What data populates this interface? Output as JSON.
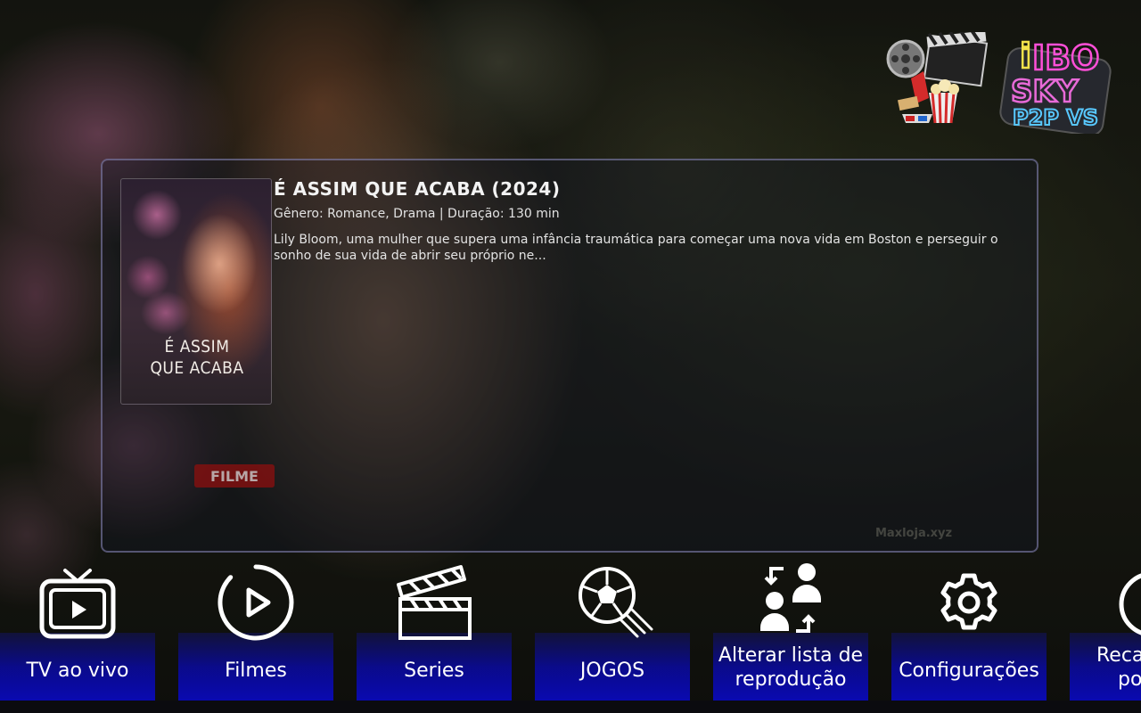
{
  "movie": {
    "title": "É ASSIM QUE ACABA (2024)",
    "meta": "Gênero: Romance, Drama | Duração: 130 min",
    "description": "Lily Bloom, uma mulher que supera uma infância traumática para começar uma nova vida em Boston e perseguir o sonho de sua vida de abrir seu próprio ne...",
    "poster_title_line1": "É ASSIM",
    "poster_title_line2": "QUE ACABA",
    "badge": "FILME"
  },
  "watermark": "Maxloja.xyz",
  "logos": {
    "brand_line1": "IBO",
    "brand_line2": "SKY",
    "brand_line3": "P2P VS"
  },
  "menu": [
    {
      "label": "TV ao vivo",
      "icon": "tv-icon"
    },
    {
      "label": "Filmes",
      "icon": "play-circle-icon"
    },
    {
      "label": "Series",
      "icon": "clapperboard-icon"
    },
    {
      "label": "JOGOS",
      "icon": "soccer-ball-icon"
    },
    {
      "label": "Alterar lista de reprodução",
      "label_line1": "Alterar lista de",
      "label_line2": "reprodução",
      "icon": "switch-users-icon"
    },
    {
      "label": "Configurações",
      "icon": "gear-icon"
    },
    {
      "label_line1": "Reca",
      "label_line2": "po",
      "icon": "reload-icon"
    }
  ],
  "colors": {
    "menu_plate": "#0a0ab0",
    "badge": "#7a1111",
    "card_border": "#8c8cbe"
  }
}
